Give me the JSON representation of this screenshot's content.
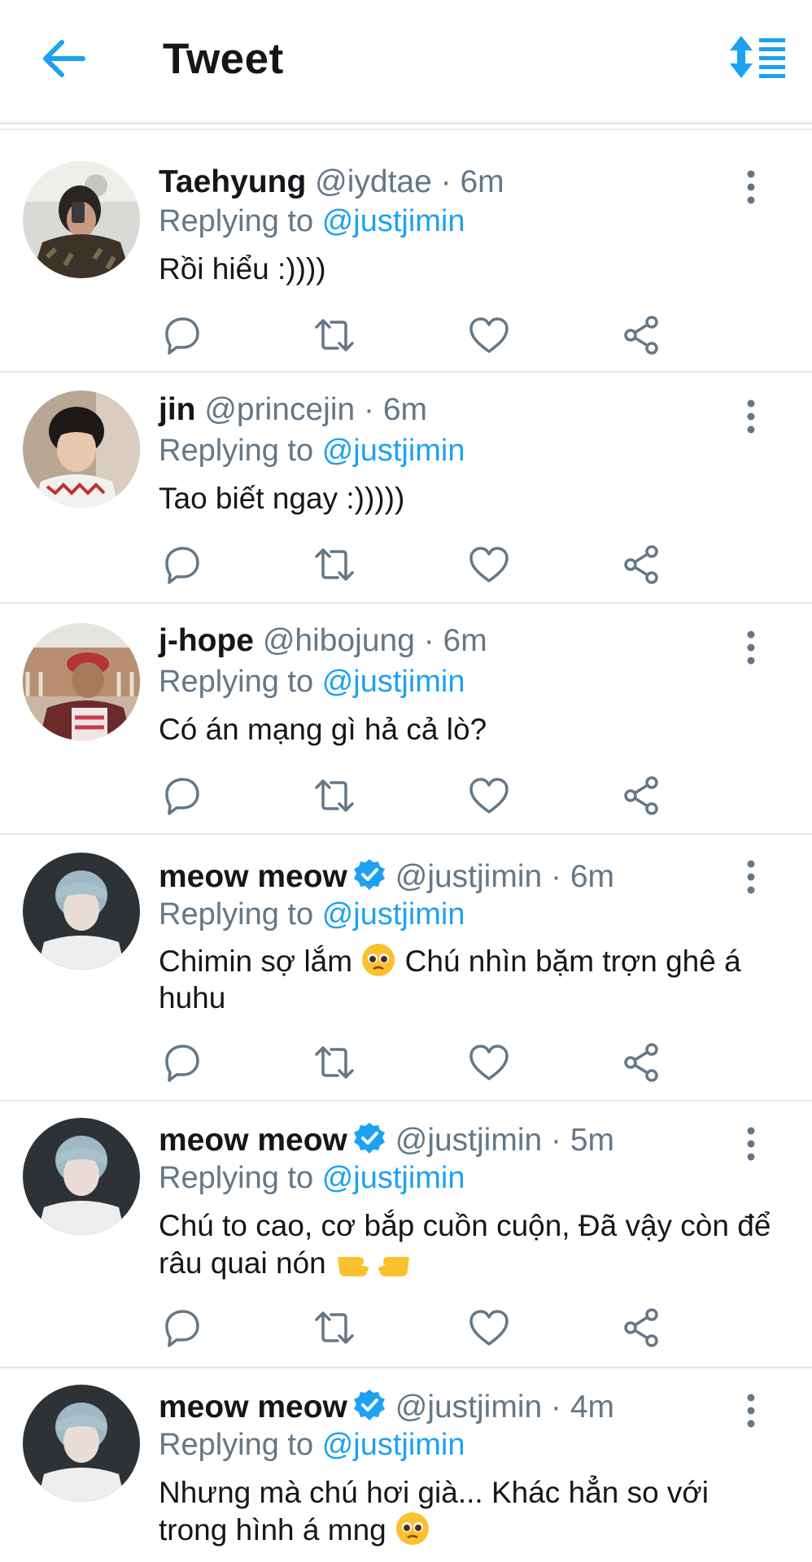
{
  "header": {
    "title": "Tweet",
    "back_icon": "arrow-left-icon",
    "sort_icon": "sort-icon",
    "accent": "#1da1f2"
  },
  "tweets": [
    {
      "name": "Taehyung",
      "handle": "@iydtae",
      "time": "· 6m",
      "verified": false,
      "replying_prefix": "Replying to",
      "replying_to": "@justjimin",
      "text": "Rồi hiểu :))))"
    },
    {
      "name": "jin",
      "handle": "@princejin",
      "time": "· 6m",
      "verified": false,
      "replying_prefix": "Replying to",
      "replying_to": "@justjimin",
      "text": "Tao biết ngay :)))))"
    },
    {
      "name": "j-hope",
      "handle": "@hibojung",
      "time": "· 6m",
      "verified": false,
      "replying_prefix": "Replying to",
      "replying_to": "@justjimin",
      "text": "Có án mạng gì hả cả lò?"
    },
    {
      "name": "meow meow",
      "handle": "@justjimin",
      "time": "· 6m",
      "verified": true,
      "replying_prefix": "Replying to",
      "replying_to": "@justjimin",
      "text_a": "Chimin sợ lắm",
      "text_b": "Chú nhìn bặm trợn ghê á huhu",
      "emoji": "pleading-face"
    },
    {
      "name": "meow meow",
      "handle": "@justjimin",
      "time": "· 5m",
      "verified": true,
      "replying_prefix": "Replying to",
      "replying_to": "@justjimin",
      "text": "Chú to cao, cơ bắp cuồn cuộn, Đã vậy còn để râu quai nón",
      "emoji": "pointing-hands"
    },
    {
      "name": "meow meow",
      "handle": "@justjimin",
      "time": "· 4m",
      "verified": true,
      "replying_prefix": "Replying to",
      "replying_to": "@justjimin",
      "text": "Nhưng mà chú hơi già... Khác hẳn so với trong hình á mng",
      "emoji": "pleading-face"
    }
  ],
  "actions": [
    "reply-icon",
    "retweet-icon",
    "like-icon",
    "share-icon"
  ],
  "colors": {
    "text": "#14171a",
    "secondary": "#657786",
    "link": "#1da1f2",
    "divider": "#e1e8ed",
    "icon": "#657786"
  }
}
